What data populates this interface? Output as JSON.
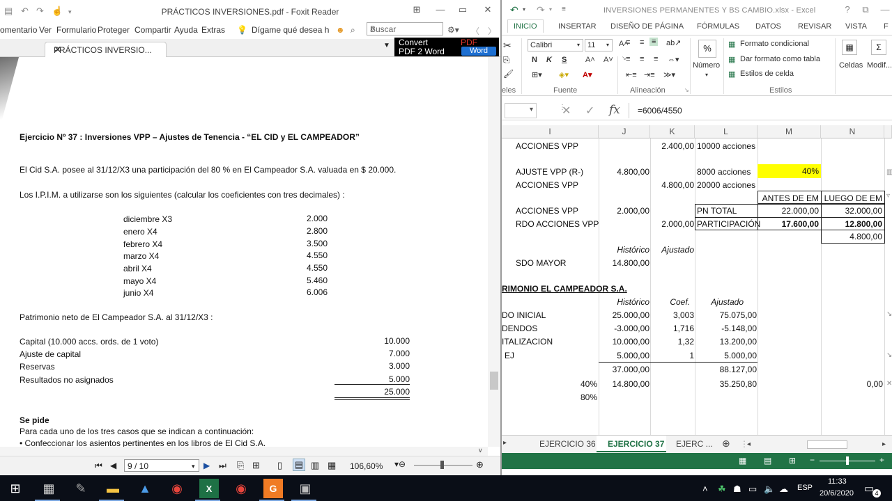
{
  "foxit": {
    "title": "PRÁCTICOS INVERSIONES.pdf - Foxit Reader",
    "menu": [
      "omentario",
      "Ver",
      "Formulario",
      "Proteger",
      "Compartir",
      "Ayuda",
      "Extras"
    ],
    "tell_me": "Dígame qué desea ha",
    "search_placeholder": "Buscar",
    "tab_label": "PRÁCTICOS INVERSIO...",
    "convert": {
      "line1": "Convert",
      "line2": "PDF 2 Word",
      "pdf": "PDF",
      "word": "Word"
    },
    "document": {
      "heading": "Ejercicio Nº 37 : Inversiones VPP – Ajustes de Tenencia - “EL CID y EL CAMPEADOR”",
      "p1": "El Cid S.A. posee al 31/12/X3 una participación del 80 % en El Campeador S.A. valuada en $ 20.000.",
      "p2": "Los I.P.I.M. a utilizarse son los siguientes (calcular los coeficientes con tres decimales) :",
      "ipim": [
        {
          "month": "diciembre X3",
          "value": "2.000"
        },
        {
          "month": "enero X4",
          "value": "2.800"
        },
        {
          "month": "febrero X4",
          "value": "3.500"
        },
        {
          "month": "marzo X4",
          "value": "4.550"
        },
        {
          "month": "abril X4",
          "value": "4.550"
        },
        {
          "month": "mayo X4",
          "value": "5.460"
        },
        {
          "month": "junio X4",
          "value": "6.006"
        }
      ],
      "p3": "Patrimonio neto de El Campeador S.A. al 31/12/X3 :",
      "equity": [
        {
          "label": "Capital (10.000 accs. ords. de 1 voto)",
          "value": "10.000"
        },
        {
          "label": "Ajuste de capital",
          "value": "7.000"
        },
        {
          "label": "Reservas",
          "value": "3.000"
        },
        {
          "label": "Resultados no asignados",
          "value": "5.000"
        }
      ],
      "equity_total": "25.000",
      "se_pide": "Se pide",
      "p4": "Para cada uno de los tres casos que se indican a continuación:",
      "p5": "• Confeccionar los asientos pertinentes en los libros de El Cid S.A."
    },
    "status": {
      "page": "9 / 10",
      "zoom": "106,60%"
    }
  },
  "excel": {
    "title": "INVERSIONES PERMANENTES Y BS CAMBIO.xlsx - Excel",
    "tabs": [
      "INICIO",
      "INSERTAR",
      "DISEÑO DE PÁGINA",
      "FÓRMULAS",
      "DATOS",
      "REVISAR",
      "VISTA",
      "F"
    ],
    "ribbon": {
      "font_name": "Calibri",
      "font_size": "11",
      "groups": [
        "eles",
        "Fuente",
        "Alineación",
        "Estilos"
      ],
      "numero": "Número",
      "formato_condicional": "Formato condicional",
      "dar_formato": "Dar formato como tabla",
      "estilos_celda": "Estilos de celda",
      "celdas": "Celdas",
      "modificar": "Modif..."
    },
    "formula": "=6006/4550",
    "columns": [
      "I",
      "J",
      "K",
      "L",
      "M",
      "N"
    ],
    "cells": {
      "r1": {
        "i": "ACCIONES VPP",
        "k": "2.400,00",
        "l": "10000 acciones"
      },
      "r3": {
        "i": "AJUSTE VPP (R-)",
        "j": "4.800,00",
        "l": "8000 acciones",
        "m": "40%"
      },
      "r4": {
        "i": "ACCIONES VPP",
        "k": "4.800,00",
        "l": "20000 acciones"
      },
      "r5": {
        "m": "ANTES DE EM",
        "n": "LUEGO DE EM"
      },
      "r6": {
        "i": "ACCIONES VPP",
        "j": "2.000,00",
        "l": "PN TOTAL",
        "m": "22.000,00",
        "n": "32.000,00"
      },
      "r7": {
        "i": "RDO ACCIONES VPP",
        "k": "2.000,00",
        "l": "PARTICIPACIÓN",
        "m": "17.600,00",
        "n": "12.800,00"
      },
      "r8": {
        "n": "4.800,00"
      },
      "r9": {
        "j": "Histórico",
        "k": "Ajustado"
      },
      "r10": {
        "i": "SDO MAYOR",
        "j": "14.800,00"
      },
      "r12": {
        "i": "RIMONIO EL CAMPEADOR S.A."
      },
      "r13": {
        "j": "Histórico",
        "k": "Coef.",
        "l": "Ajustado"
      },
      "r14": {
        "i": "DO INICIAL",
        "j": "25.000,00",
        "k": "3,003",
        "l": "75.075,00"
      },
      "r15": {
        "i": "DENDOS",
        "j": "-3.000,00",
        "k": "1,716",
        "l": "-5.148,00"
      },
      "r16": {
        "i": "ITALIZACION",
        "j": "10.000,00",
        "k": "1,32",
        "l": "13.200,00"
      },
      "r17": {
        "i": "EJ",
        "j": "5.000,00",
        "k": "1",
        "l": "5.000,00"
      },
      "r18": {
        "j": "37.000,00",
        "l": "88.127,00"
      },
      "r19": {
        "i": "40%",
        "j": "14.800,00",
        "l": "35.250,80",
        "n": "0,00"
      },
      "r20": {
        "i": "80%"
      }
    },
    "sheets": [
      "EJERCICIO 36",
      "EJERCICIO 37",
      "EJERC ..."
    ]
  },
  "taskbar": {
    "lang": "ESP",
    "time": "11:33",
    "date": "20/6/2020",
    "notif": "4"
  }
}
